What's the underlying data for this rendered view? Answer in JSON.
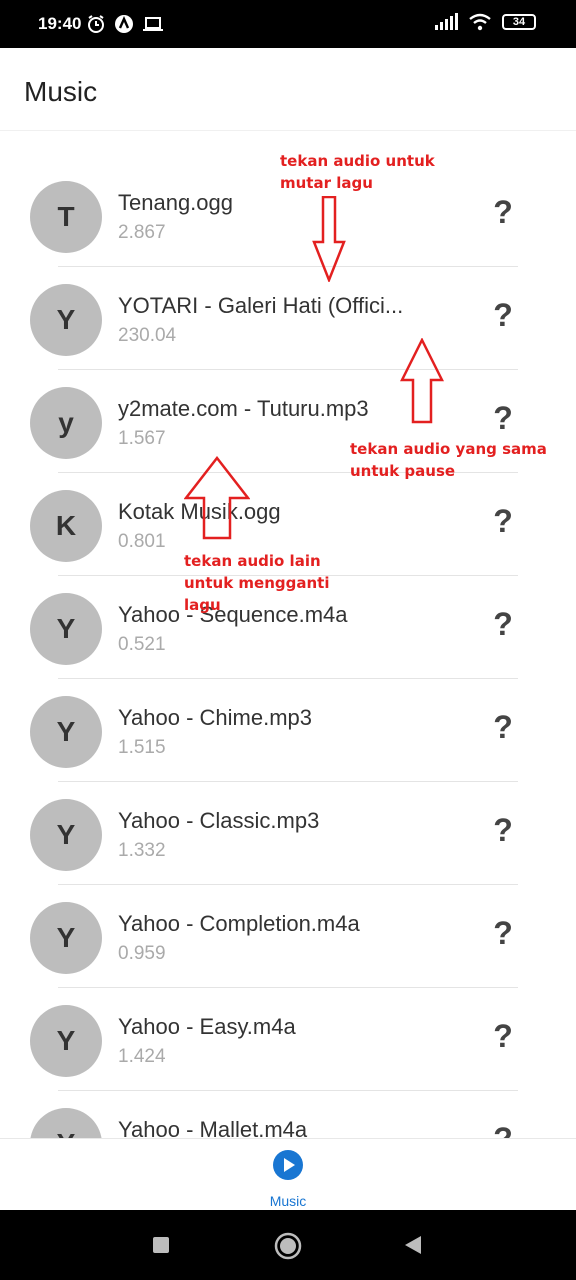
{
  "status_bar": {
    "time": "19:40",
    "battery": "34"
  },
  "app_bar": {
    "title": "Music"
  },
  "tracks": [
    {
      "initial": "T",
      "name": "Tenang.ogg",
      "size": "2.867"
    },
    {
      "initial": "Y",
      "name": "YOTARI - Galeri Hati (Offici...",
      "size": "230.04"
    },
    {
      "initial": "y",
      "name": "y2mate.com - Tuturu.mp3",
      "size": "1.567"
    },
    {
      "initial": "K",
      "name": "Kotak Musik.ogg",
      "size": "0.801"
    },
    {
      "initial": "Y",
      "name": "Yahoo - Sequence.m4a",
      "size": "0.521"
    },
    {
      "initial": "Y",
      "name": "Yahoo - Chime.mp3",
      "size": "1.515"
    },
    {
      "initial": "Y",
      "name": "Yahoo - Classic.mp3",
      "size": "1.332"
    },
    {
      "initial": "Y",
      "name": "Yahoo - Completion.m4a",
      "size": "0.959"
    },
    {
      "initial": "Y",
      "name": "Yahoo - Easy.m4a",
      "size": "1.424"
    },
    {
      "initial": "Y",
      "name": "Yahoo - Mallet.m4a",
      "size": ""
    }
  ],
  "annotations": {
    "play": "tekan audio untuk mutar lagu",
    "pause": "tekan audio yang sama untuk pause",
    "change": "tekan audio lain untuk mengganti lagu"
  },
  "bottom_nav": {
    "music_label": "Music",
    "active_color": "#1976d2"
  },
  "icons": {
    "row_action": "question-mark-icon",
    "tab": "play-circle-icon"
  }
}
